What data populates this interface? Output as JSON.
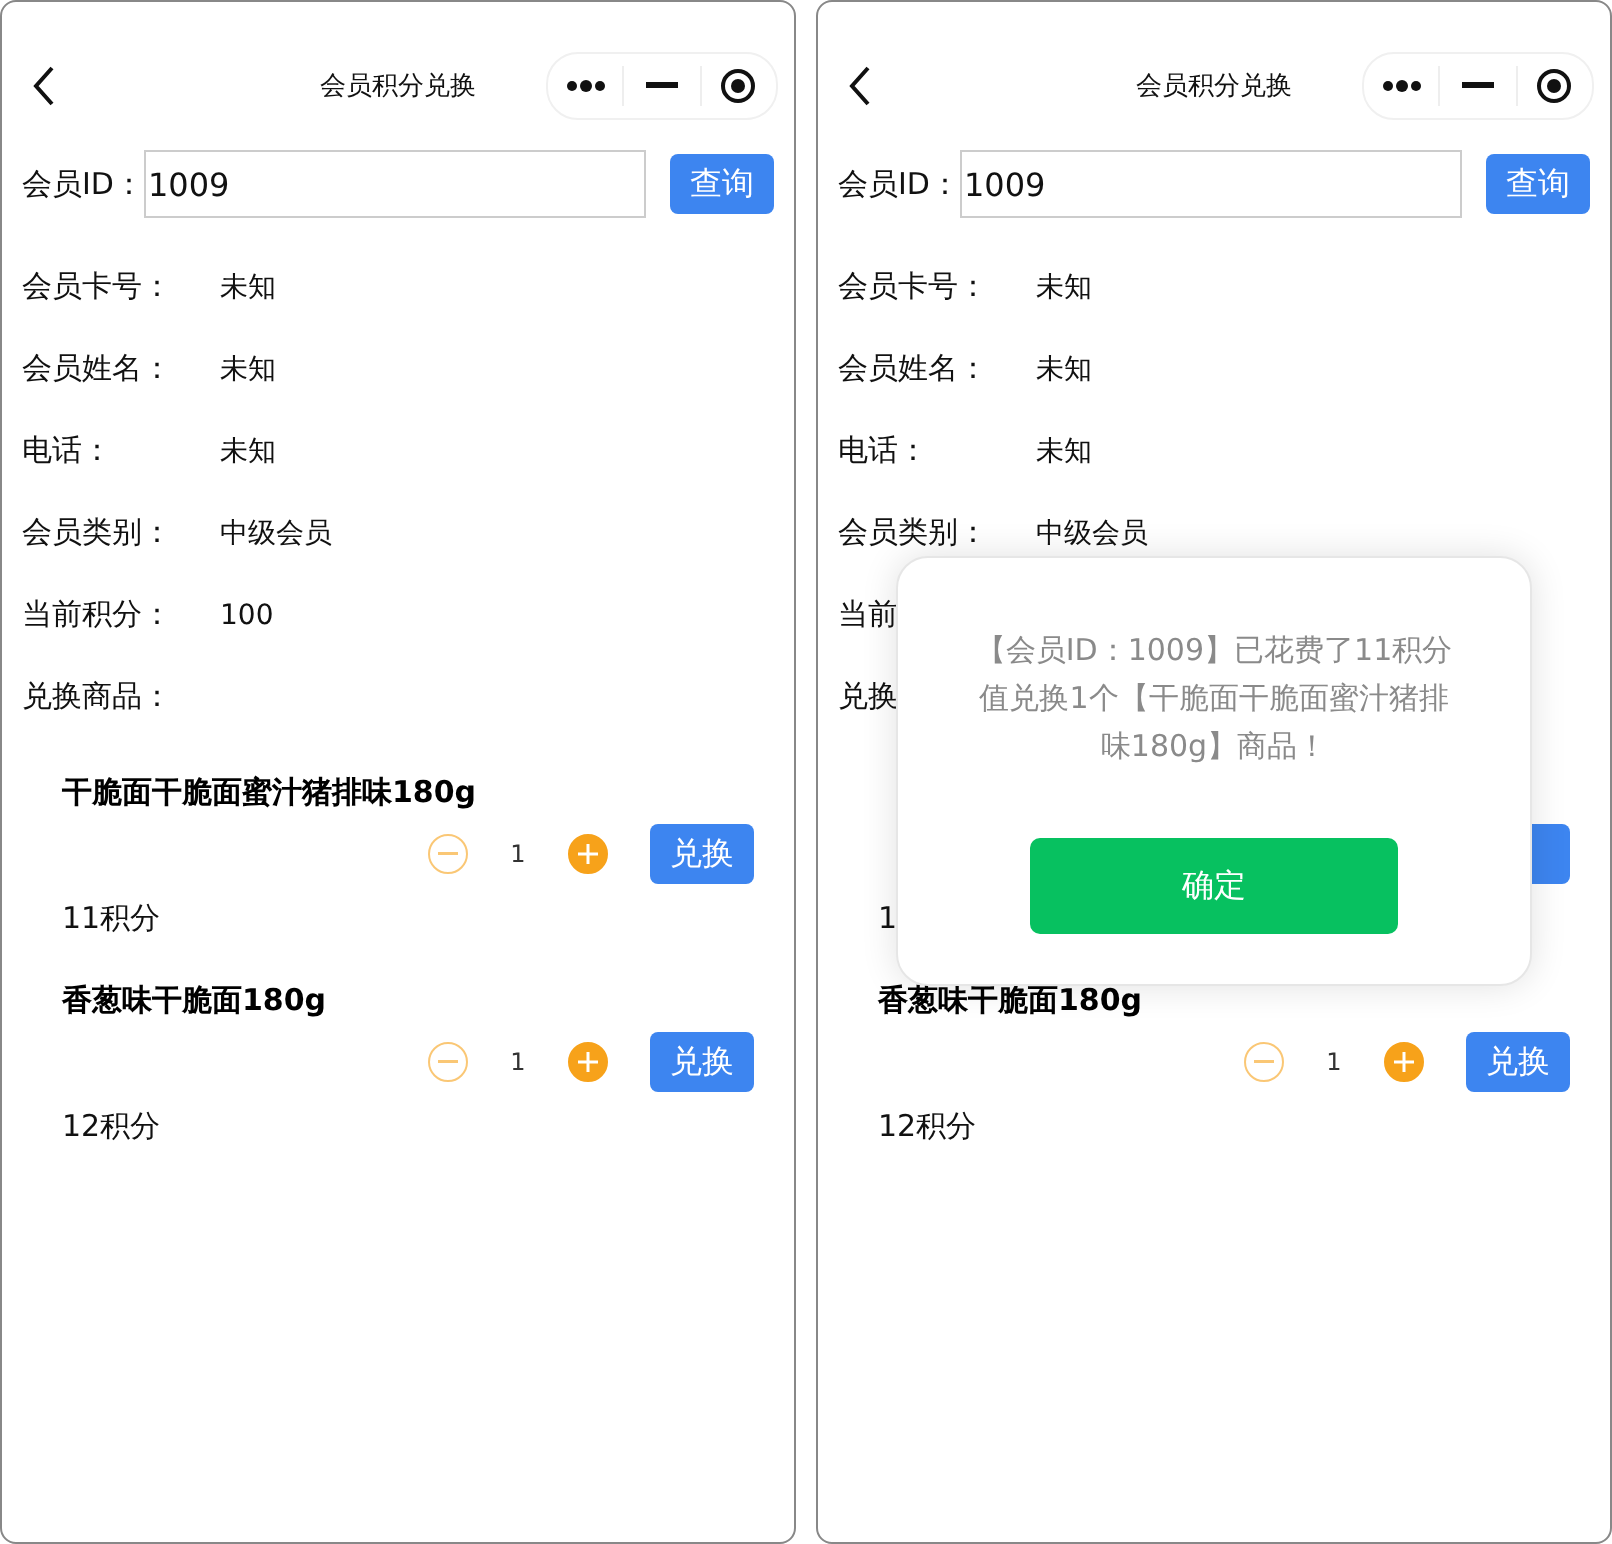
{
  "screens": [
    {
      "title": "会员积分兑换",
      "id_label": "会员ID：",
      "id_value": "1009",
      "query_button": "查询",
      "fields": [
        {
          "label": "会员卡号：",
          "value": "未知"
        },
        {
          "label": "会员姓名：",
          "value": "未知"
        },
        {
          "label": "电话：",
          "value": "未知"
        },
        {
          "label": "会员类别：",
          "value": "中级会员"
        },
        {
          "label": "当前积分：",
          "value": "100"
        },
        {
          "label": "兑换商品："
        }
      ],
      "products": [
        {
          "kind": "full",
          "title": "干脆面干脆面蜜汁猪排味180g",
          "quantity": "1",
          "minus_disabled": true,
          "button": "兑换",
          "points": "11积分"
        },
        {
          "kind": "full",
          "title": "香葱味干脆面180g",
          "quantity": "1",
          "minus_disabled": true,
          "button": "兑换",
          "points": "12积分"
        }
      ]
    },
    {
      "title": "会员积分兑换",
      "id_label": "会员ID：",
      "id_value": "1009",
      "query_button": "查询",
      "fields": [
        {
          "label": "会员卡号：",
          "value": "未知"
        },
        {
          "label": "会员姓名：",
          "value": "未知"
        },
        {
          "label": "电话：",
          "value": "未知"
        },
        {
          "label": "会员类别：",
          "value": "中级会员"
        },
        {
          "label": "当前"
        },
        {
          "label": "兑换"
        }
      ],
      "products": [
        {
          "kind": "covered",
          "points": "1"
        },
        {
          "kind": "full",
          "title": "香葱味干脆面180g",
          "quantity": "1",
          "minus_disabled": true,
          "button": "兑换",
          "points": "12积分"
        }
      ],
      "dialog": {
        "message": "【会员ID：1009】已花费了11积分值兑换1个【干脆面干脆面蜜汁猪排味180g】商品！",
        "confirm": "确定"
      }
    }
  ]
}
